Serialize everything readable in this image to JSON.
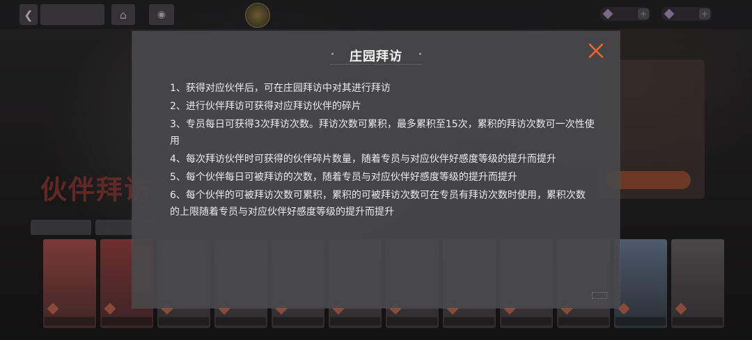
{
  "dialog": {
    "title": "庄园拜访",
    "close_icon": "close-x-icon",
    "close_color": "#f0662a",
    "rules": [
      "1、获得对应伙伴后，可在庄园拜访中对其进行拜访",
      "2、进行伙伴拜访可获得对应拜访伙伴的碎片",
      "3、专员每日可获得3次拜访次数。拜访次数可累积，最多累积至15次，累积的拜访次数可一次性使用",
      "4、每次拜访伙伴时可获得的伙伴碎片数量，随着专员与对应伙伴好感度等级的提升而提升",
      "5、每个伙伴每日可被拜访的次数，随着专员与对应伙伴好感度等级的提升而提升",
      "6、每个伙伴的可被拜访次数可累积，累积的可被拜访次数可在专员有拜访次数时使用，累积次数的上限随着专员与对应伙伴好感度等级的提升而提升"
    ]
  },
  "background": {
    "logo_text": "伙伴拜访",
    "topbar": {
      "back_icon": "back-arrow-icon",
      "home_icon": "home-icon"
    }
  }
}
